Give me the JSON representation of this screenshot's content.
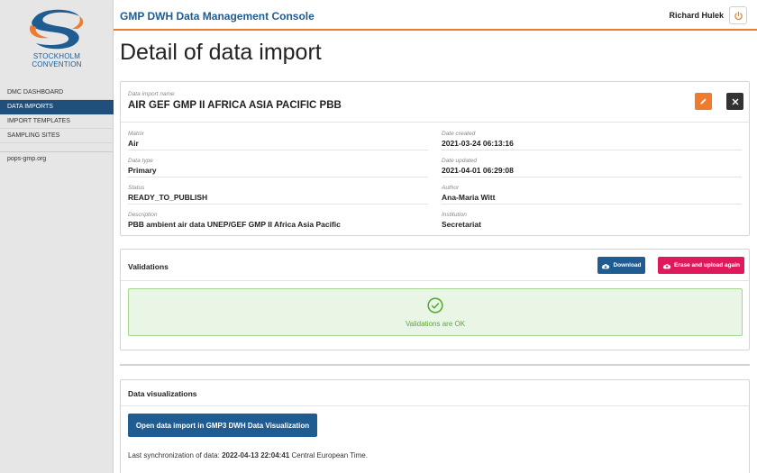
{
  "sidebar": {
    "logo_text_line1": "STOCKHOLM",
    "logo_text_line2": "CONVENTION",
    "items": [
      {
        "label": "DMC DASHBOARD",
        "active": false
      },
      {
        "label": "DATA IMPORTS",
        "active": true
      },
      {
        "label": "IMPORT TEMPLATES",
        "active": false
      },
      {
        "label": "SAMPLING SITES",
        "active": false
      }
    ],
    "external_link": "pops-gmp.org"
  },
  "header": {
    "app_title": "GMP DWH Data Management Console",
    "user_name": "Richard Hulek",
    "power_icon": "power-icon"
  },
  "page": {
    "title": "Detail of data import"
  },
  "import_card": {
    "name_label": "Data import name",
    "name_value": "AIR GEF GMP II AFRICA ASIA PACIFIC PBB",
    "fields_left": [
      {
        "label": "Matrix",
        "value": "Air"
      },
      {
        "label": "Data type",
        "value": "Primary"
      },
      {
        "label": "Status",
        "value": "READY_TO_PUBLISH"
      },
      {
        "label": "Description",
        "value": "PBB ambient air data UNEP/GEF GMP II Africa Asia Pacific"
      }
    ],
    "fields_right": [
      {
        "label": "Date created",
        "value": "2021-03-24 06:13:16"
      },
      {
        "label": "Date updated",
        "value": "2021-04-01 06:29:08"
      },
      {
        "label": "Author",
        "value": "Ana-Maria Witt"
      },
      {
        "label": "Institution",
        "value": "Secretariat"
      }
    ],
    "colors": {
      "edit": "#f07a2d",
      "close": "#333333"
    }
  },
  "validations": {
    "title": "Validations",
    "download_label": "Download",
    "erase_label": "Erase and upload again",
    "ok_text": "Validations are OK",
    "colors": {
      "download": "#1f5c91",
      "erase": "#e0195c",
      "ok": "#5aa83a"
    }
  },
  "visualizations": {
    "title": "Data visualizations",
    "open_button_label": "Open data import in GMP3 DWH Data Visualization",
    "sync_prefix": "Last synchronization of data:",
    "sync_value": "2022-04-13 22:04:41",
    "sync_suffix": "Central European Time."
  }
}
